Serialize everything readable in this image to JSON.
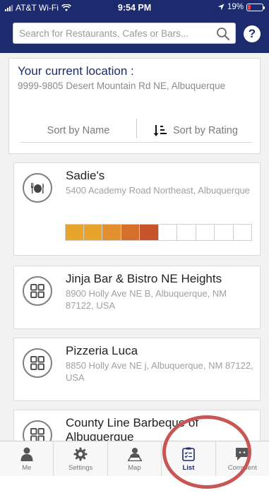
{
  "status_bar": {
    "carrier": "AT&T Wi-Fi",
    "time": "9:54 PM",
    "battery": "19%"
  },
  "search": {
    "placeholder": "Search for Restaurants, Cafes or Bars..."
  },
  "location": {
    "title": "Your current location :",
    "address": "9999-9805 Desert Mountain Rd NE, Albuquerque"
  },
  "sort": {
    "by_name": "Sort by Name",
    "by_rating": "Sort by Rating"
  },
  "restaurants": [
    {
      "name": "Sadie's",
      "address": "5400 Academy Road Northeast, Albuquerque",
      "icon": "dining-icon",
      "rating_segments": [
        "#e8a42b",
        "#e8a42b",
        "#e39130",
        "#d4702c",
        "#c9532a",
        "",
        "",
        "",
        "",
        ""
      ]
    },
    {
      "name": "Jinja Bar & Bistro NE Heights",
      "address": "8900 Holly Ave NE B, Albuquerque, NM 87122, USA",
      "icon": "grid-icon"
    },
    {
      "name": "Pizzeria Luca",
      "address": "8850 Holly Ave NE j, Albuquerque, NM 87122, USA",
      "icon": "grid-icon"
    },
    {
      "name": "County Line Barbeque of Albuquerque",
      "address": "",
      "icon": "grid-icon"
    }
  ],
  "tabs": [
    {
      "label": "Me",
      "icon": "person-icon"
    },
    {
      "label": "Settings",
      "icon": "gear-icon"
    },
    {
      "label": "Map",
      "icon": "map-person-icon"
    },
    {
      "label": "List",
      "icon": "list-icon",
      "active": true
    },
    {
      "label": "Comment",
      "icon": "comment-icon"
    }
  ],
  "colors": {
    "header": "#1c2a6e",
    "highlight": "#c75656"
  }
}
